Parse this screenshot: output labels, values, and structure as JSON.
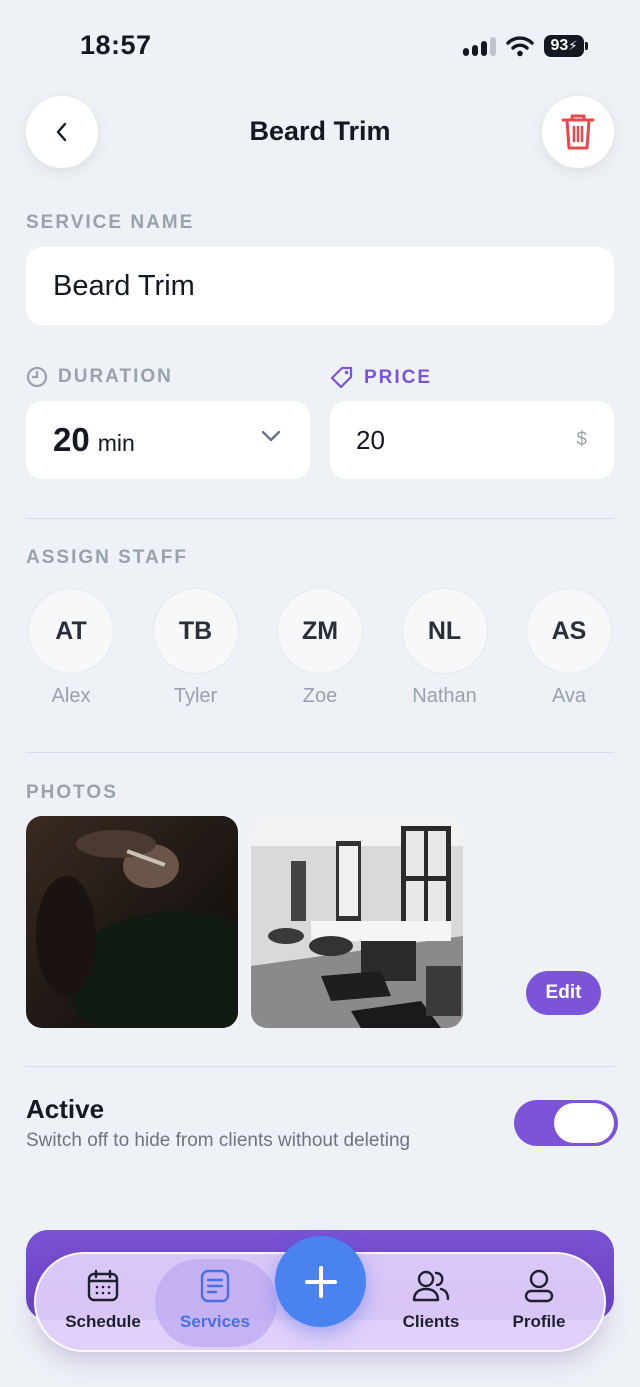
{
  "status": {
    "time": "18:57",
    "battery": "93"
  },
  "header": {
    "title": "Beard Trim",
    "back_icon": "chevron-left-icon",
    "delete_icon": "trash-icon"
  },
  "service_name": {
    "label": "SERVICE NAME",
    "value": "Beard Trim"
  },
  "duration": {
    "label": "DURATION",
    "value": "20",
    "unit": "min"
  },
  "price": {
    "label": "PRICE",
    "value": "20",
    "currency": "$"
  },
  "staff": {
    "label": "ASSIGN STAFF",
    "members": [
      {
        "initials": "AT",
        "name": "Alex"
      },
      {
        "initials": "TB",
        "name": "Tyler"
      },
      {
        "initials": "ZM",
        "name": "Zoe"
      },
      {
        "initials": "NL",
        "name": "Nathan"
      },
      {
        "initials": "AS",
        "name": "Ava"
      }
    ]
  },
  "photos": {
    "label": "PHOTOS",
    "edit_label": "Edit"
  },
  "active": {
    "title": "Active",
    "subtitle": "Switch off to hide from clients without deleting",
    "enabled": true
  },
  "tabs": [
    {
      "label": "Schedule",
      "icon": "calendar-icon"
    },
    {
      "label": "Services",
      "icon": "list-icon",
      "selected": true
    },
    {
      "label": "Clients",
      "icon": "users-icon"
    },
    {
      "label": "Profile",
      "icon": "user-icon"
    }
  ],
  "colors": {
    "accent": "#7b54d8",
    "fab": "#4a82f0",
    "danger": "#e5484d",
    "background": "#eef1f6"
  }
}
